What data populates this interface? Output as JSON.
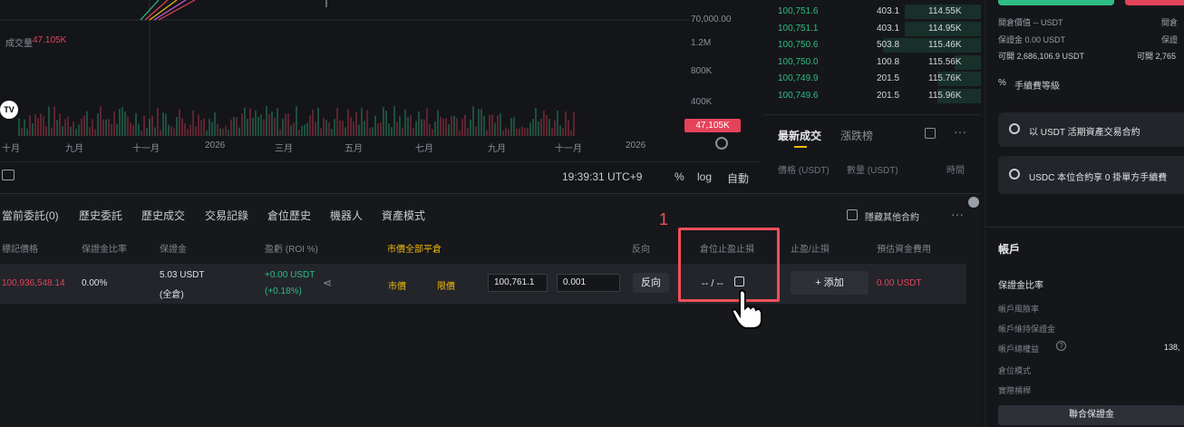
{
  "chart": {
    "price_labels": [
      "70,000.00",
      "1.2M",
      "800K",
      "400K"
    ],
    "current_price_badge": "47,105K",
    "volume_label": "成交量",
    "volume_value": "47.105K",
    "time_labels": [
      "十月",
      "九月",
      "十一月",
      "2026",
      "三月",
      "五月",
      "七月",
      "九月",
      "十一月",
      "2026"
    ],
    "tv_logo": "TV",
    "footer": {
      "time": "19:39:31 UTC+9",
      "pct": "%",
      "log": "log",
      "auto": "自動"
    },
    "colors": {
      "up": "#2ebd85",
      "down": "#e5435a"
    }
  },
  "orderbook": {
    "rows": [
      {
        "price": "100,751.6",
        "qty": "403.1",
        "total": "114.55K"
      },
      {
        "price": "100,751.1",
        "qty": "403.1",
        "total": "114.95K"
      },
      {
        "price": "100,750.6",
        "qty": "503.8",
        "total": "115.46K"
      },
      {
        "price": "100,750.0",
        "qty": "100.8",
        "total": "115.56K"
      },
      {
        "price": "100,749.9",
        "qty": "201.5",
        "total": "115.76K"
      },
      {
        "price": "100,749.6",
        "qty": "201.5",
        "total": "115.96K"
      }
    ],
    "bar_fractions": [
      0.35,
      0.35,
      0.45,
      0.12,
      0.2,
      0.2
    ]
  },
  "trades": {
    "tab_latest": "最新成交",
    "tab_movers": "漲跌榜",
    "col_price": "價格 (USDT)",
    "col_qty": "數量 (USDT)",
    "col_time": "時間"
  },
  "right_panel": {
    "cost_label": "開倉價值 -- USDT",
    "cost_label_r": "開倉",
    "margin_label": "保證金 0.00 USDT",
    "margin_label_r": "保證",
    "avail_label": "可開 2,686,106.9 USDT",
    "avail_label_r": "可開 2,765",
    "fee_level": "手續費等級",
    "promo1": "以 USDT 活期資產交易合約",
    "promo2": "USDC 本位合約享 0 掛單方手續費",
    "account_title": "帳戶",
    "margin_ratio": "保證金比率",
    "acct_risk": "帳戶風險率",
    "acct_maint": "帳戶維持保證金",
    "acct_equity": "帳戶總權益",
    "acct_equity_val": "138,",
    "pos_mode": "倉位模式",
    "pnl": "實際槓桿",
    "joint_margin_btn": "聯合保證金"
  },
  "positions": {
    "tabs": [
      "當前委託(0)",
      "歷史委託",
      "歷史成交",
      "交易記錄",
      "倉位歷史",
      "機器人",
      "資產模式"
    ],
    "hide_other": "隱藏其他合約",
    "more": "···",
    "headers": {
      "mark": "標記價格",
      "margin_ratio": "保證金比率",
      "margin": "保證金",
      "pnl": "盈虧 (ROI %)",
      "close_all": "市價全部平倉",
      "reverse": "反向",
      "tpsl_pos": "倉位止盈止損",
      "tpsl": "止盈/止損",
      "est_fee": "預估資金費用"
    },
    "row": {
      "mark": "100,936,548.14",
      "margin_ratio": "0.00%",
      "margin": "5.03 USDT",
      "margin_mode": "(全倉)",
      "pnl": "+0.00 USDT",
      "roi": "(+0.18%)",
      "market": "市價",
      "limit": "限價",
      "price_input": "100,761.1",
      "qty_input": "0.001",
      "reverse_btn": "反向",
      "tpsl_value": "-- / --",
      "add_btn": "添加",
      "add_plus": "+",
      "est_fee": "0.00 USDT"
    },
    "annotation": "1"
  }
}
